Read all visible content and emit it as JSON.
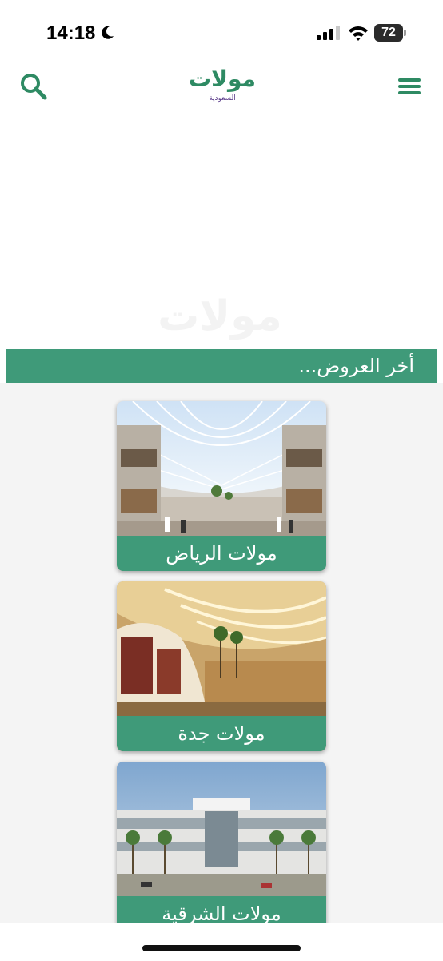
{
  "status_bar": {
    "time": "14:18",
    "battery": "72",
    "icons": [
      "moon-icon",
      "signal-icon",
      "wifi-icon",
      "battery-icon"
    ]
  },
  "header": {
    "logo_text": "مولات",
    "logo_subtext": "السعودية",
    "search_icon": "search-icon",
    "menu_icon": "menu-icon",
    "brand_color": "#2e8a63"
  },
  "section": {
    "title": "أخر العروض..."
  },
  "cards": [
    {
      "label": "مولات الرياض",
      "image": "riyadh-mall-image"
    },
    {
      "label": "مولات جدة",
      "image": "jeddah-mall-image"
    },
    {
      "label": "مولات الشرقية",
      "image": "eastern-mall-image"
    }
  ],
  "colors": {
    "accent": "#3f9a79",
    "content_bg": "#f4f4f4"
  }
}
